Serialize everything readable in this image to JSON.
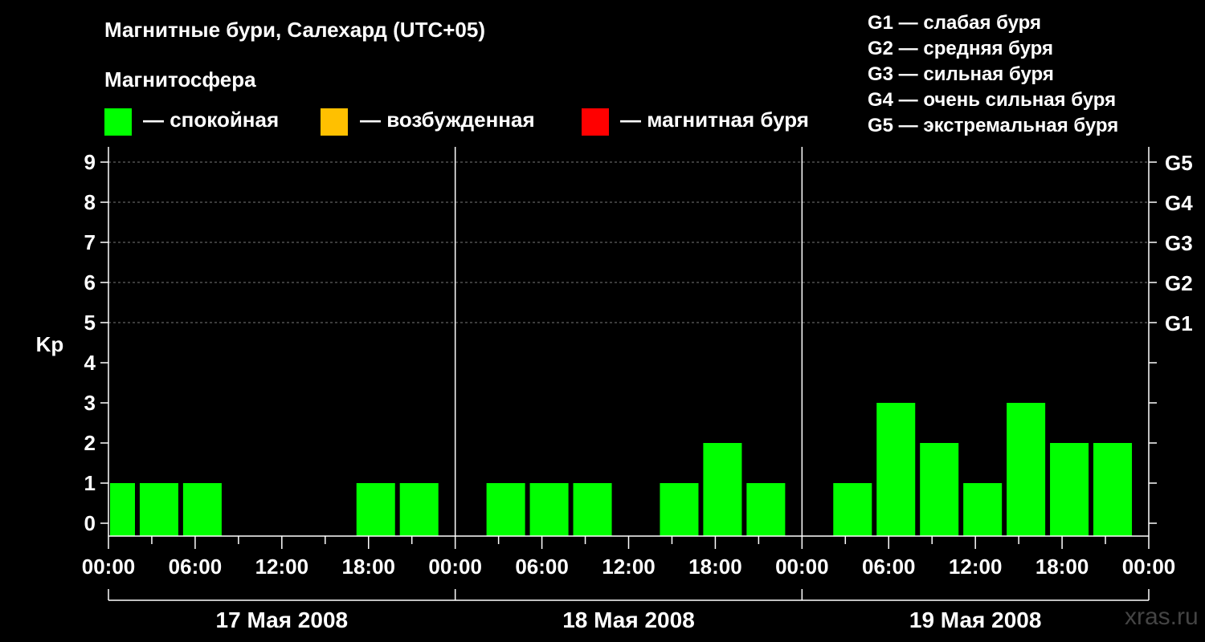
{
  "title": "Магнитные бури, Салехард (UTC+05)",
  "subtitle": "Магнитосфера",
  "legend": [
    {
      "color": "#00ff00",
      "label": "— спокойная"
    },
    {
      "color": "#ffc000",
      "label": "— возбужденная"
    },
    {
      "color": "#ff0000",
      "label": "— магнитная буря"
    }
  ],
  "g_scale": [
    "G1 — слабая буря",
    "G2 — средняя буря",
    "G3 — сильная буря",
    "G4 — очень сильная буря",
    "G5 — экстремальная буря"
  ],
  "watermark": "xras.ru",
  "chart_data": {
    "type": "bar",
    "ylabel": "Kp",
    "ylim": [
      0,
      9
    ],
    "y_ticks": [
      "0",
      "1",
      "2",
      "3",
      "4",
      "5",
      "6",
      "7",
      "8",
      "9"
    ],
    "right_ticks": [
      {
        "value": 5,
        "label": "G1"
      },
      {
        "value": 6,
        "label": "G2"
      },
      {
        "value": 7,
        "label": "G3"
      },
      {
        "value": 8,
        "label": "G4"
      },
      {
        "value": 9,
        "label": "G5"
      }
    ],
    "grid": "dashed horizontal at 5-9",
    "x_tick_labels": [
      "00:00",
      "06:00",
      "12:00",
      "18:00",
      "00:00",
      "06:00",
      "12:00",
      "18:00",
      "00:00",
      "06:00",
      "12:00",
      "18:00",
      "00:00"
    ],
    "days": [
      "17 Мая 2008",
      "18 Мая 2008",
      "19 Мая 2008"
    ],
    "interval_hours": 3,
    "values": [
      [
        1,
        1,
        1,
        null,
        null,
        null,
        1,
        1
      ],
      [
        null,
        1,
        1,
        1,
        null,
        1,
        2,
        1
      ],
      [
        null,
        1,
        3,
        2,
        1,
        3,
        2,
        2
      ]
    ],
    "bar_color": "#00ff00"
  }
}
